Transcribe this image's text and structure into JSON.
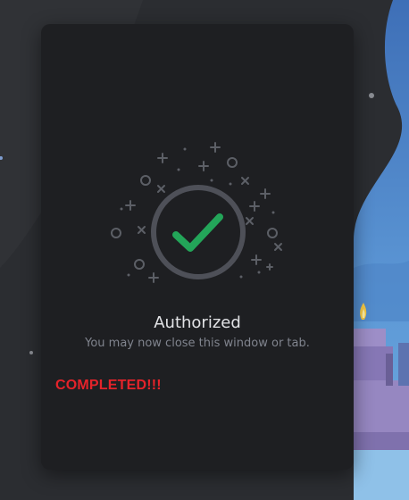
{
  "dialog": {
    "title": "Authorized",
    "subtitle": "You may now close this window or tab.",
    "status_icon": "check-circle-icon"
  },
  "annotation": {
    "text": "COMPLETED!!!",
    "color": "#e5232a"
  },
  "colors": {
    "page_background": "#2b2d31",
    "card_background": "#1e1f22",
    "accent_green": "#23a559",
    "sky_blue": "#5a8fd0"
  }
}
